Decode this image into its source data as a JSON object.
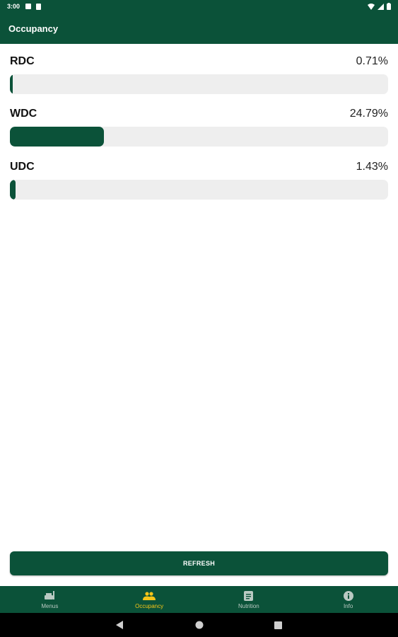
{
  "status_bar": {
    "time": "3:00"
  },
  "app_bar": {
    "title": "Occupancy"
  },
  "occupancy": [
    {
      "name": "RDC",
      "percent_label": "0.71%",
      "value": 0.71
    },
    {
      "name": "WDC",
      "percent_label": "24.79%",
      "value": 24.79
    },
    {
      "name": "UDC",
      "percent_label": "1.43%",
      "value": 1.43
    }
  ],
  "refresh_label": "REFRESH",
  "bottom_nav": {
    "items": [
      {
        "label": "Menus",
        "icon": "menus-icon"
      },
      {
        "label": "Occupancy",
        "icon": "people-icon"
      },
      {
        "label": "Nutrition",
        "icon": "nutrition-icon"
      },
      {
        "label": "Info",
        "icon": "info-icon"
      }
    ],
    "active": "Occupancy"
  },
  "colors": {
    "primary": "#0b5239",
    "accent": "#f5c518",
    "track": "#eeeeee"
  }
}
